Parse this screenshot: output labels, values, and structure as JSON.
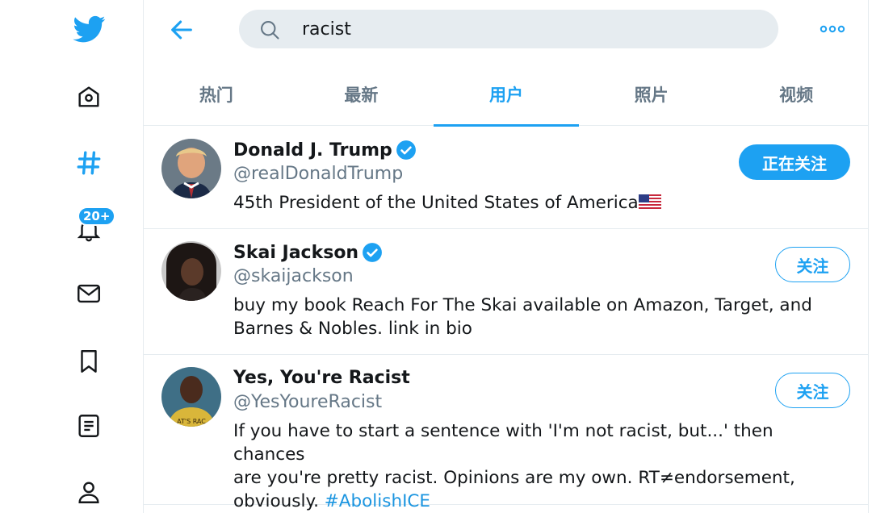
{
  "search": {
    "query": "racist"
  },
  "notifications": {
    "badge": "20+"
  },
  "tabs": [
    {
      "label": "热门",
      "active": false
    },
    {
      "label": "最新",
      "active": false
    },
    {
      "label": "用户",
      "active": true
    },
    {
      "label": "照片",
      "active": false
    },
    {
      "label": "视频",
      "active": false
    }
  ],
  "users": [
    {
      "name": "Donald J. Trump",
      "verified": true,
      "handle": "@realDonaldTrump",
      "bio": "45th President of the United States of America",
      "bio_flag": "us-flag",
      "button": "正在关注"
    },
    {
      "name": "Skai Jackson",
      "verified": true,
      "handle": "@skaijackson",
      "bio_line1": "buy my book Reach For The Skai available on Amazon, Target, and",
      "bio_line2": "Barnes & Nobles. link in bio",
      "button": "关注"
    },
    {
      "name": "Yes, You're Racist",
      "verified": false,
      "handle": "@YesYoureRacist",
      "bio_line1": "If you have to start a sentence with 'I'm not racist, but...' then chances",
      "bio_line2": "are you're pretty racist. Opinions are my own. RT≠endorsement,",
      "bio_line3": "obviously. ",
      "bio_hashtag": "#AbolishICE",
      "button": "关注"
    }
  ],
  "colors": {
    "accent": "#1da1f2",
    "secondary_text": "#657786",
    "border": "#e6ecf0"
  }
}
